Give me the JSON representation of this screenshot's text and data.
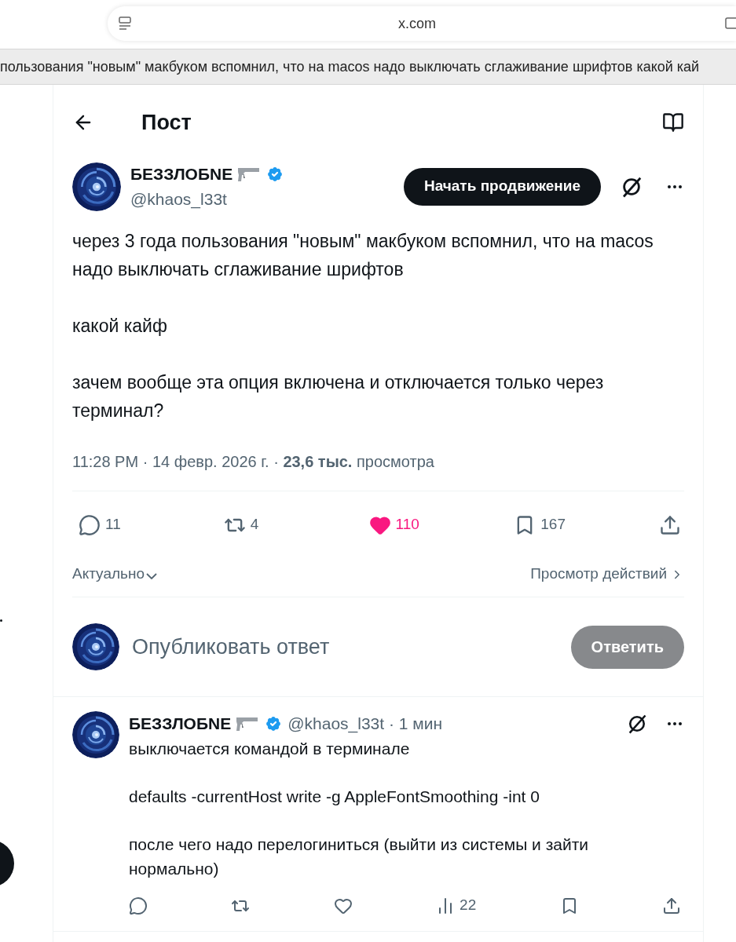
{
  "browser": {
    "url": "x.com",
    "tab_title": "пользования \"новым\" макбуком вспомнил, что на macos надо выключать сглаживание шрифтов какой кай"
  },
  "header": {
    "title": "Пост"
  },
  "post": {
    "author": {
      "name": "БЕЗЗЛОБNE",
      "handle": "@khaos_l33t",
      "verified": true
    },
    "promote_button": "Начать продвижение",
    "body": [
      "через 3 года пользования \"новым\" макбуком вспомнил, что на macos надо выключать сглаживание шрифтов",
      "какой кайф",
      "зачем вообще эта опция включена и отключается только через терминал?"
    ],
    "meta": "11:28 PM · 14 февр. 2026 г. · **23,6 тыс.** просмотра",
    "actions": [
      {
        "kind": "reply",
        "count": "11",
        "active": false
      },
      {
        "kind": "repost",
        "count": "4",
        "active": false
      },
      {
        "kind": "like",
        "count": "110",
        "active": true
      },
      {
        "kind": "bookmark",
        "count": "167",
        "active": false
      },
      {
        "kind": "share",
        "active": false
      }
    ],
    "sort": "Актуально",
    "activity_link": "Просмотр действий"
  },
  "reply_box": {
    "placeholder": "Опубликовать ответ",
    "button": "Ответить",
    "disabled": true
  },
  "replies": [
    {
      "name": "БЕЗЗЛОБNE",
      "verified": true,
      "handle_time": "@khaos_l33t · 1 мин",
      "body": [
        "выключается командой в терминале",
        "defaults -currentHost write -g AppleFontSmoothing -int 0",
        "после чего надо перелогиниться (выйти из системы и зайти нормально)"
      ],
      "actions": [
        {
          "kind": "reply",
          "active": false
        },
        {
          "kind": "repost",
          "active": false
        },
        {
          "kind": "like",
          "active": false
        },
        {
          "kind": "views",
          "count": "22",
          "active": false
        },
        {
          "kind": "bookmark",
          "active": false
        },
        {
          "kind": "share",
          "active": false
        }
      ]
    }
  ]
}
